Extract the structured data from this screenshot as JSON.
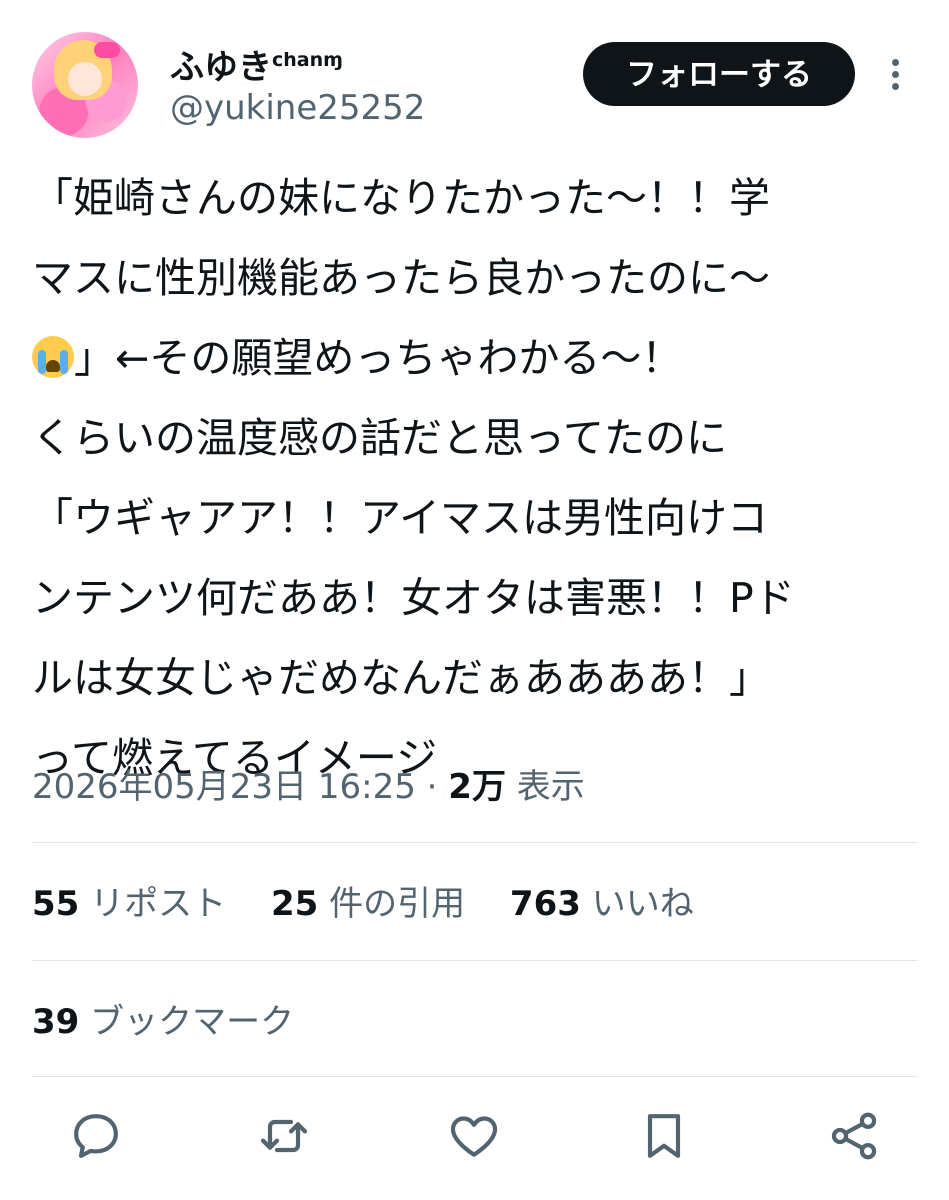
{
  "user": {
    "display_name": "ふゆき",
    "name_suffix": "chan",
    "name_emoji": "ɱ",
    "handle": "@yukine25252"
  },
  "follow_label": "フォローする",
  "tweet_lines": [
    "「姫崎さんの妹になりたかった〜！！学",
    "マスに性別機能あったら良かったのに〜",
    "」←その願望めっちゃわかる〜！",
    "くらいの温度感の話だと思ってたのに",
    "「ウギャアア！！アイマスは男性向けコ",
    "ンテンツ何だああ！女オタは害悪！！Pド",
    "ルは女女じゃだめなんだぁああああ！」",
    "って燃えてるイメージ"
  ],
  "meta": {
    "timestamp": "2026年05月23日 16:25",
    "separator": "·",
    "views_count": "2万",
    "views_label": "表示"
  },
  "stats": {
    "reposts_count": "55",
    "reposts_label": "リポスト",
    "quotes_count": "25",
    "quotes_label": "件の引用",
    "likes_count": "763",
    "likes_label": "いいね",
    "bookmarks_count": "39",
    "bookmarks_label": "ブックマーク"
  },
  "icons": {
    "reply": "speech-bubble-icon",
    "repost": "repost-arrows-icon",
    "like": "heart-icon",
    "bookmark": "bookmark-icon",
    "share": "share-icon",
    "more": "vertical-dots-icon",
    "emoji": "loudly-crying-face-emoji"
  },
  "colors": {
    "text": "#0f1419",
    "secondary": "#536471",
    "button_bg": "#0f1419",
    "button_text": "#ffffff",
    "divider": "#e1e5e8"
  }
}
